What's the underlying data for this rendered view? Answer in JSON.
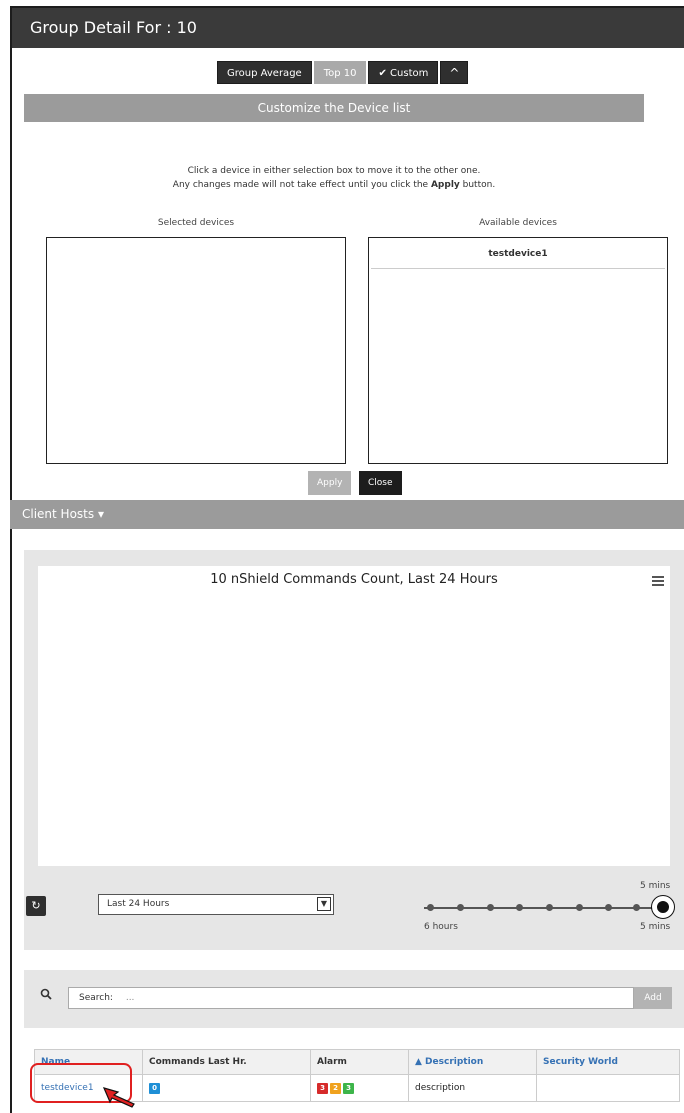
{
  "title": "Group Detail For : 10",
  "toolbar": {
    "group_average": "Group Average",
    "top10": "Top 10",
    "custom": "Custom",
    "custom_check": "✔",
    "collapse": "^"
  },
  "customize": {
    "header": "Customize the Device list",
    "instruction1": "Click a device in either selection box to move it to the other one.",
    "instruction2_pre": "Any changes made will not take effect until you click the ",
    "instruction2_bold": "Apply",
    "instruction2_post": " button.",
    "selected_label": "Selected devices",
    "available_label": "Available devices",
    "available_items": [
      "testdevice1"
    ],
    "apply": "Apply",
    "close": "Close"
  },
  "client_hosts": "Client Hosts ▾",
  "chart": {
    "title": "10 nShield Commands Count, Last 24 Hours",
    "range_value": "Last 24 Hours",
    "refresh_glyph": "↻",
    "slider_top_label": "5 mins",
    "slider_left_label": "6 hours",
    "slider_right_label": "5 mins"
  },
  "search": {
    "icon": "magnifier-icon",
    "label": "Search:",
    "placeholder": "...",
    "add": "Add"
  },
  "table": {
    "headers": [
      "Name",
      "Commands Last Hr.",
      "Alarm",
      "▲ Description",
      "Security World"
    ],
    "rows": [
      {
        "name": "testdevice1",
        "commands": "0",
        "alarms": [
          "3",
          "2",
          "3"
        ],
        "description": "description",
        "security_world": ""
      }
    ]
  },
  "colors": {
    "title_bg": "#3a3a3a",
    "header_gray": "#9b9b9b",
    "link_blue": "#3571b4",
    "alarm_red": "#d62b2b",
    "alarm_orange": "#f0a21e",
    "alarm_green": "#3db54a",
    "badge_blue": "#1e8fd6",
    "highlight_red": "#e02020"
  }
}
